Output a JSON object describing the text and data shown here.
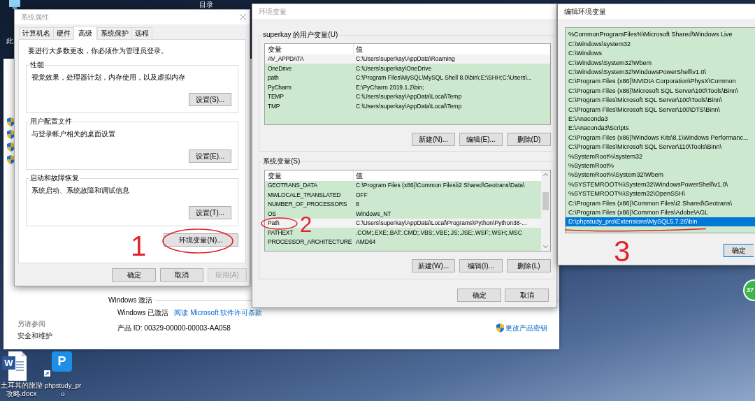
{
  "desktop": {
    "top_label": "目录",
    "icons": [
      {
        "kind": "computer",
        "label": "此"
      },
      {
        "kind": "document",
        "badge": "W",
        "label": "土耳其的旅游攻略.docx"
      },
      {
        "kind": "shortcut",
        "badge": "P",
        "label": "phpstudy_pro"
      }
    ],
    "floating_ball": {
      "text": "37"
    }
  },
  "settings_window": {
    "see_also": {
      "heading": "另请参阅",
      "links": [
        "安全和维护"
      ]
    },
    "activation": {
      "heading": "Windows 激活",
      "status": "Windows 已激活",
      "license_link": "阅读 Microsoft 软件许可条款",
      "product_id": "产品 ID: 00329-00000-00003-AA058",
      "change_key_link": "更改产品密钥"
    }
  },
  "system_properties": {
    "title": "系统属性",
    "active": false,
    "tabs": [
      {
        "label": "计算机名",
        "selected": false
      },
      {
        "label": "硬件",
        "selected": false
      },
      {
        "label": "高级",
        "selected": true
      },
      {
        "label": "系统保护",
        "selected": false
      },
      {
        "label": "远程",
        "selected": false
      }
    ],
    "notice": "要进行大多数更改，你必须作为管理员登录。",
    "groups": [
      {
        "title": "性能",
        "description": "视觉效果，处理器计划，内存使用，以及虚拟内存",
        "button": "设置(S)..."
      },
      {
        "title": "用户配置文件",
        "description": "与登录帐户相关的桌面设置",
        "button": "设置(E)..."
      },
      {
        "title": "启动和故障恢复",
        "description": "系统启动、系统故障和调试信息",
        "button": "设置(T)..."
      }
    ],
    "env_button": {
      "label": "环境变量(N)...",
      "circled": true,
      "annotation": "1"
    },
    "buttons": [
      {
        "label": "确定",
        "disabled": false
      },
      {
        "label": "取消",
        "disabled": false
      },
      {
        "label": "应用(A)",
        "disabled": true
      }
    ]
  },
  "environment_variables": {
    "title": "环境变量",
    "active": false,
    "sections": [
      {
        "title": "superkay 的用户变量(U)",
        "columns": [
          "变量",
          "值"
        ],
        "scrollbar": false,
        "rows": [
          {
            "name": "AV_APPDATA",
            "value": "C:\\Users\\superkay\\AppData\\Roaming",
            "selected": true,
            "circled": false
          },
          {
            "name": "OneDrive",
            "value": "C:\\Users\\superkay\\OneDrive",
            "selected": false,
            "circled": false
          },
          {
            "name": "path",
            "value": "C:\\Program Files\\MySQL\\MySQL Shell 8.0\\bin\\;E:\\SHH;C:\\Users\\...",
            "selected": false,
            "circled": false
          },
          {
            "name": "PyCharm",
            "value": "E:\\PyCharm 2019.1.2\\bin;",
            "selected": false,
            "circled": false
          },
          {
            "name": "TEMP",
            "value": "C:\\Users\\superkay\\AppData\\Local\\Temp",
            "selected": false,
            "circled": false
          },
          {
            "name": "TMP",
            "value": "C:\\Users\\superkay\\AppData\\Local\\Temp",
            "selected": false,
            "circled": false
          }
        ],
        "buttons": [
          "新建(N)...",
          "编辑(E)...",
          "删除(D)"
        ]
      },
      {
        "title": "系统变量(S)",
        "columns": [
          "变量",
          "值"
        ],
        "scrollbar": true,
        "rows": [
          {
            "name": "GEOTRANS_DATA",
            "value": "C:\\Program Files (x86)\\Common Files\\i2 Shared\\Geotrans\\Data\\",
            "selected": false,
            "circled": false
          },
          {
            "name": "MWLOCALE_TRANSLATED",
            "value": "OFF",
            "selected": false,
            "circled": false
          },
          {
            "name": "NUMBER_OF_PROCESSORS",
            "value": "8",
            "selected": false,
            "circled": false
          },
          {
            "name": "OS",
            "value": "Windows_NT",
            "selected": false,
            "circled": false
          },
          {
            "name": "Path",
            "value": "C:\\Users\\superkay\\AppData\\Local\\Programs\\Python\\Python38-...",
            "selected": true,
            "circled": true,
            "annotation": "2"
          },
          {
            "name": "PATHEXT",
            "value": ".COM;.EXE;.BAT;.CMD;.VBS;.VBE;.JS;.JSE;.WSF;.WSH;.MSC",
            "selected": false,
            "circled": false
          },
          {
            "name": "PROCESSOR_ARCHITECTURE",
            "value": "AMD64",
            "selected": false,
            "circled": false
          }
        ],
        "buttons": [
          "新建(W)...",
          "编辑(I)...",
          "删除(L)"
        ]
      }
    ],
    "buttons": [
      "确定",
      "取消"
    ]
  },
  "edit_environment_variable": {
    "title": "编辑环境变量",
    "active": true,
    "entries": [
      {
        "text": "%CommonProgramFiles%\\Microsoft Shared\\Windows Live",
        "selected": false,
        "underlined": false
      },
      {
        "text": "C:\\Windows\\system32",
        "selected": false,
        "underlined": false
      },
      {
        "text": "C:\\Windows",
        "selected": false,
        "underlined": false
      },
      {
        "text": "C:\\Windows\\System32\\Wbem",
        "selected": false,
        "underlined": false
      },
      {
        "text": "C:\\Windows\\System32\\WindowsPowerShell\\v1.0\\",
        "selected": false,
        "underlined": false
      },
      {
        "text": "C:\\Program Files (x86)\\NVIDIA Corporation\\PhysX\\Common",
        "selected": false,
        "underlined": false
      },
      {
        "text": "C:\\Program Files (x86)\\Microsoft SQL Server\\100\\Tools\\Binn\\",
        "selected": false,
        "underlined": false
      },
      {
        "text": "C:\\Program Files\\Microsoft SQL Server\\100\\Tools\\Binn\\",
        "selected": false,
        "underlined": false
      },
      {
        "text": "C:\\Program Files\\Microsoft SQL Server\\100\\DTS\\Binn\\",
        "selected": false,
        "underlined": false
      },
      {
        "text": "E:\\Anaconda3",
        "selected": false,
        "underlined": false
      },
      {
        "text": "E:\\Anaconda3\\Scripts",
        "selected": false,
        "underlined": false
      },
      {
        "text": "C:\\Program Files (x86)\\Windows Kits\\8.1\\Windows Performanc...",
        "selected": false,
        "underlined": false
      },
      {
        "text": "C:\\Program Files\\Microsoft SQL Server\\110\\Tools\\Binn\\",
        "selected": false,
        "underlined": false
      },
      {
        "text": "%SystemRoot%\\system32",
        "selected": false,
        "underlined": false
      },
      {
        "text": "%SystemRoot%",
        "selected": false,
        "underlined": false
      },
      {
        "text": "%SystemRoot%\\System32\\Wbem",
        "selected": false,
        "underlined": false
      },
      {
        "text": "%SYSTEMROOT%\\System32\\WindowsPowerShell\\v1.0\\",
        "selected": false,
        "underlined": false
      },
      {
        "text": "%SYSTEMROOT%\\System32\\OpenSSH\\",
        "selected": false,
        "underlined": false
      },
      {
        "text": "C:\\Program Files (x86)\\Common Files\\i2 Shared\\Geotrans\\",
        "selected": false,
        "underlined": false
      },
      {
        "text": "C:\\Program Files (x86)\\Common Files\\Adobe\\AGL",
        "selected": false,
        "underlined": false
      },
      {
        "text": "D:\\phpstudy_pro\\Extensions\\MySQL5.7.26\\bin",
        "selected": true,
        "underlined": true,
        "annotation": "3"
      }
    ],
    "buttons": [
      {
        "label": "确定",
        "focused": true
      }
    ]
  }
}
